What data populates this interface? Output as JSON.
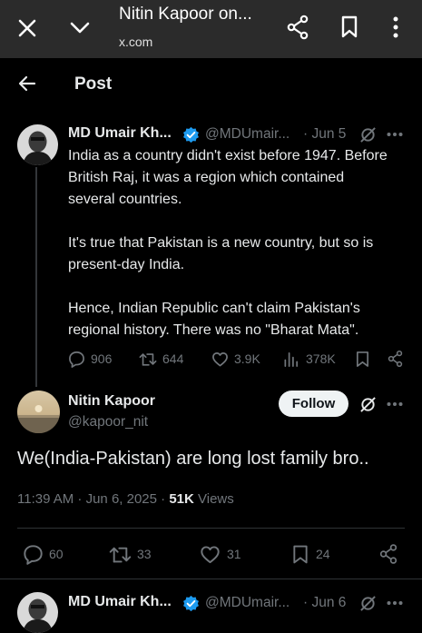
{
  "browser": {
    "title": "Nitin Kapoor on...",
    "domain": "x.com"
  },
  "header": {
    "title": "Post"
  },
  "parent_post": {
    "name": "MD Umair Kh...",
    "handle": "@MDUmair...",
    "date": "· Jun 5",
    "paragraphs": [
      "India as a country didn't exist before 1947. Before British Raj, it was a region which contained several countries.",
      "It's true that Pakistan is a new country, but so is present-day India.",
      "Hence, Indian Republic can't claim Pakistan's regional history. There was no \"Bharat Mata\"."
    ],
    "replies": "906",
    "reposts": "644",
    "likes": "3.9K",
    "views": "378K"
  },
  "main_post": {
    "name": "Nitin Kapoor",
    "handle": "@kapoor_nit",
    "follow_label": "Follow",
    "text": "We(India-Pakistan) are long lost family bro..",
    "timestamp": "11:39 AM · Jun 6, 2025 · ",
    "views_count": "51K",
    "views_label": " Views",
    "replies": "60",
    "reposts": "33",
    "likes": "31",
    "bookmarks": "24"
  },
  "next_post": {
    "name": "MD Umair Kh...",
    "handle": "@MDUmair...",
    "date": "· Jun 6"
  },
  "colors": {
    "background": "#000000",
    "browser_bar": "#2b2b2b",
    "text_primary": "#e7e9ea",
    "text_secondary": "#71767b",
    "verified": "#1d9bf0",
    "divider": "#2f3336"
  },
  "icons": [
    "close-icon",
    "chevron-down-icon",
    "share-icon",
    "bookmark-icon",
    "more-vertical-icon",
    "back-arrow-icon",
    "verified-badge-icon",
    "grok-icon",
    "more-horizontal-icon",
    "reply-icon",
    "repost-icon",
    "like-icon",
    "views-icon"
  ]
}
